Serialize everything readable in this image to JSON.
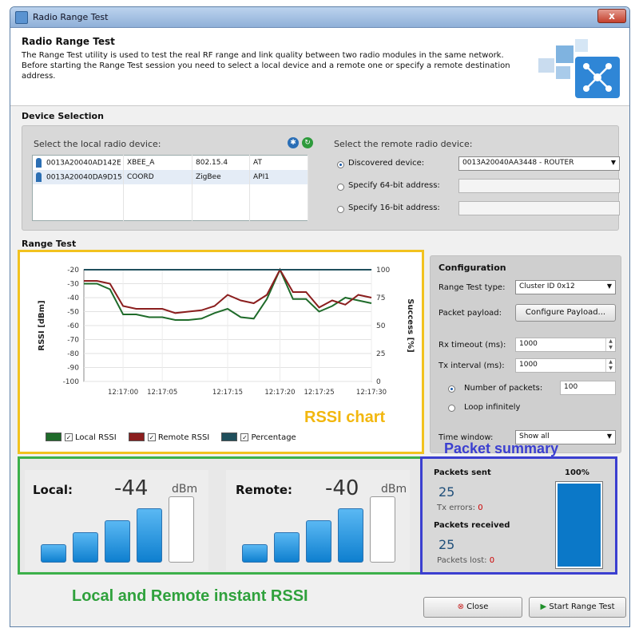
{
  "window": {
    "title": "Radio Range Test",
    "close_label": "x"
  },
  "header": {
    "title": "Radio Range Test",
    "description": "The Range Test utility is used to test the real RF range and link quality between two radio modules in the same network. Before starting the Range Test session you need to select a local device and a remote one or specify a remote destination address."
  },
  "device_selection": {
    "title": "Device Selection",
    "local_label": "Select the local radio device:",
    "devices": [
      {
        "address": "0013A20040AD142E",
        "name": "XBEE_A",
        "protocol": "802.15.4",
        "mode": "AT"
      },
      {
        "address": "0013A20040DA9D15",
        "name": "COORD",
        "protocol": "ZigBee",
        "mode": "API1"
      }
    ],
    "remote_label": "Select the remote radio device:",
    "remote_options": [
      {
        "label": "Discovered device:",
        "selected": true
      },
      {
        "label": "Specify 64-bit address:",
        "selected": false
      },
      {
        "label": "Specify 16-bit address:",
        "selected": false
      }
    ],
    "discovered_value": "0013A20040AA3448 - ROUTER"
  },
  "range_test": {
    "title": "Range Test"
  },
  "chart_data": {
    "type": "line",
    "x": [
      "12:16:56",
      "12:16:58",
      "12:16:59",
      "12:17:00",
      "12:17:01",
      "12:17:03",
      "12:17:05",
      "12:17:07",
      "12:17:09",
      "12:17:11",
      "12:17:13",
      "12:17:15",
      "12:17:17",
      "12:17:18",
      "12:17:19",
      "12:17:20",
      "12:17:21",
      "12:17:23",
      "12:17:25",
      "12:17:27",
      "12:17:28",
      "12:17:29",
      "12:17:30"
    ],
    "x_ticks": [
      "12:17:00",
      "12:17:05",
      "12:17:10",
      "12:17:15",
      "12:17:20",
      "12:17:25",
      "12:17:30"
    ],
    "series": [
      {
        "name": "Local RSSI",
        "color": "#1f6b2a",
        "axis": "left",
        "values": [
          -30,
          -30,
          -34,
          -52,
          -52,
          -54,
          -54,
          -56,
          -56,
          -55,
          -51,
          -48,
          -54,
          -55,
          -41,
          -20,
          -41,
          -41,
          -50,
          -46,
          -40,
          -42,
          -44
        ]
      },
      {
        "name": "Remote RSSI",
        "color": "#8b1e1e",
        "axis": "left",
        "values": [
          -28,
          -28,
          -30,
          -46,
          -48,
          -48,
          -48,
          -51,
          -50,
          -49,
          -46,
          -38,
          -42,
          -44,
          -38,
          -20,
          -36,
          -36,
          -47,
          -42,
          -45,
          -38,
          -40
        ]
      },
      {
        "name": "Percentage",
        "color": "#1f4f5c",
        "axis": "right",
        "values": [
          100,
          100,
          100,
          100,
          100,
          100,
          100,
          100,
          100,
          100,
          100,
          100,
          100,
          100,
          100,
          100,
          100,
          100,
          100,
          100,
          100,
          100,
          100
        ]
      }
    ],
    "left_axis": {
      "label": "RSSI [dBm]",
      "min": -100,
      "max": -20,
      "ticks": [
        -20,
        -30,
        -40,
        -50,
        -60,
        -70,
        -80,
        -90,
        -100
      ]
    },
    "right_axis": {
      "label": "Success [%]",
      "min": 0,
      "max": 100,
      "ticks": [
        100,
        75,
        50,
        25,
        0
      ]
    },
    "grid": true,
    "legend_placement": "bottom"
  },
  "annotations": {
    "rssi_chart": "RSSI chart",
    "packet_summary": "Packet summary",
    "instant_rssi": "Local and Remote instant RSSI"
  },
  "configuration": {
    "title": "Configuration",
    "type_label": "Range Test type:",
    "type_value": "Cluster ID 0x12",
    "payload_label": "Packet payload:",
    "payload_button": "Configure Payload...",
    "rx_label": "Rx timeout (ms):",
    "rx_value": "1000",
    "tx_label": "Tx interval (ms):",
    "tx_value": "1000",
    "num_packets_label": "Number of packets:",
    "num_packets_value": "100",
    "loop_label": "Loop infinitely",
    "time_window_label": "Time window:",
    "time_window_value": "Show all"
  },
  "rssi": {
    "local": {
      "label": "Local:",
      "value": "-44",
      "unit": "dBm",
      "level_bars": 4,
      "total_bars": 5
    },
    "remote": {
      "label": "Remote:",
      "value": "-40",
      "unit": "dBm",
      "level_bars": 4,
      "total_bars": 5
    }
  },
  "packets": {
    "sent_label": "Packets sent",
    "sent_value": "25",
    "tx_errors_label": "Tx errors:",
    "tx_errors_value": "0",
    "received_label": "Packets received",
    "received_value": "25",
    "lost_label": "Packets lost:",
    "lost_value": "0",
    "percent_label": "100%",
    "percent_fill": 1.0
  },
  "footer": {
    "close_label": "Close",
    "start_label": "Start Range Test"
  },
  "colors": {
    "accent": "#1a5aa8",
    "chart_border": "#f2c21e",
    "rssi_border": "#3cb04a",
    "packet_border": "#3b3fd0",
    "annotation_yellow": "#f2b70f",
    "annotation_green": "#2fa13c",
    "annotation_blue": "#3b3fd0"
  }
}
